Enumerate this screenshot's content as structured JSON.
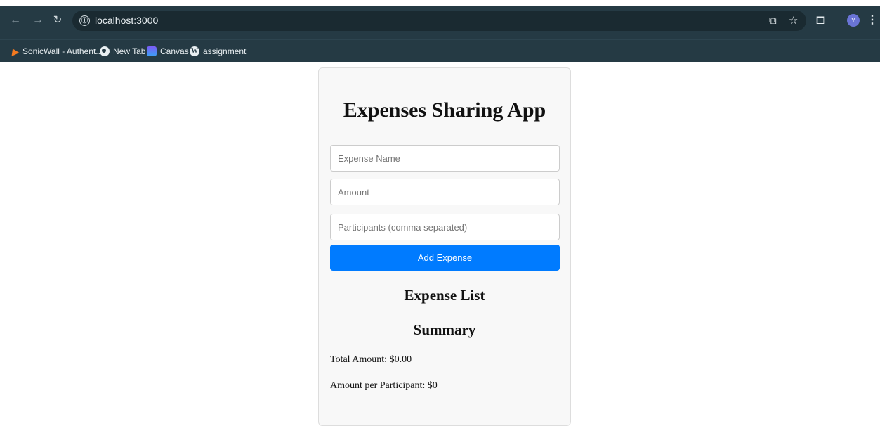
{
  "browser": {
    "url": "localhost:3000",
    "site_info_glyph": "ⓘ",
    "bookmarks": [
      {
        "label": "SonicWall - Authent...",
        "icon": "sonicwall-icon"
      },
      {
        "label": "New Tab",
        "icon": "globe-icon"
      },
      {
        "label": "Canvas",
        "icon": "canvas-icon"
      },
      {
        "label": "assignment",
        "icon": "wordpress-icon"
      }
    ],
    "avatar_letter": "Y",
    "colors": {
      "chrome": "#253a44",
      "omnibox": "#1a2a31",
      "avatar": "#6a74d6"
    }
  },
  "app": {
    "title": "Expenses Sharing App",
    "form": {
      "expense_name_placeholder": "Expense Name",
      "amount_placeholder": "Amount",
      "participants_placeholder": "Participants (comma separated)",
      "add_button_label": "Add Expense"
    },
    "expense_list_heading": "Expense List",
    "summary_heading": "Summary",
    "total_amount_text": "Total Amount: $0.00",
    "per_participant_text": "Amount per Participant: $0",
    "colors": {
      "button": "#007bff",
      "card": "#f8f8f8"
    }
  }
}
